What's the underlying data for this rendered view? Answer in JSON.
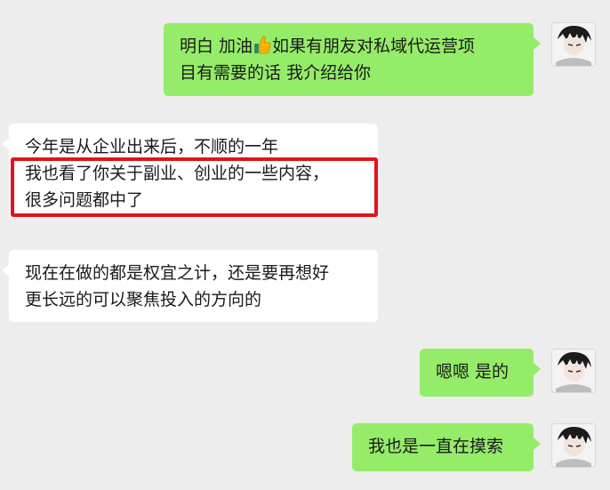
{
  "messages": [
    {
      "side": "right",
      "lines": [
        "明白  加油",
        "如果有朋友对私域代运营项",
        "目有需要的话 我介绍给你"
      ],
      "emoji": "thumbs-up"
    },
    {
      "side": "left",
      "lines": [
        "今年是从企业出来后，不顺的一年",
        "我也看了你关于副业、创业的一些内容，",
        "很多问题都中了"
      ]
    },
    {
      "side": "left",
      "lines": [
        "现在在做的都是权宜之计，还是要再想好",
        "更长远的可以聚焦投入的方向的"
      ]
    },
    {
      "side": "right",
      "lines": [
        "嗯嗯 是的"
      ]
    },
    {
      "side": "right",
      "lines": [
        "我也是一直在摸索"
      ]
    }
  ],
  "highlight_color": "#e0141c",
  "colors": {
    "sent_bubble": "#95ec69",
    "received_bubble": "#ffffff",
    "background": "#ededed"
  },
  "icons": [
    "thumbs-up-icon",
    "avatar-icon"
  ]
}
